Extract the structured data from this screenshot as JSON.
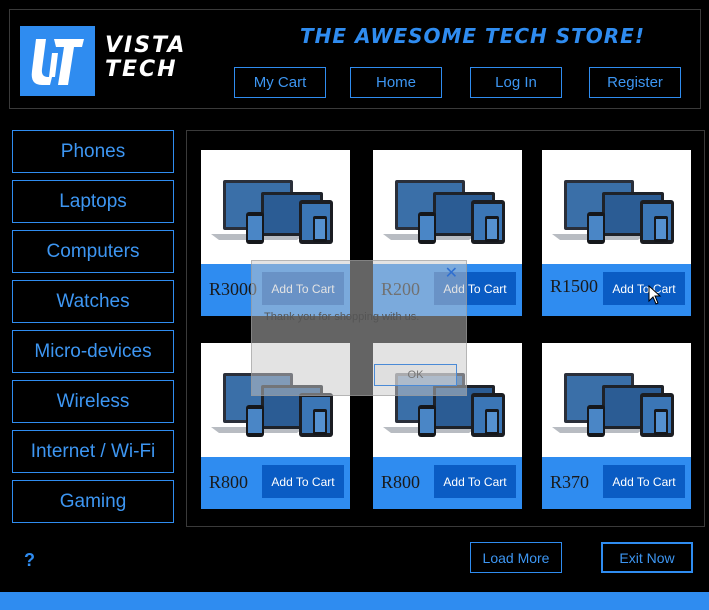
{
  "header": {
    "logo_text": "VISTA TECH",
    "tagline": "THE AWESOME TECH STORE!",
    "nav": [
      "My Cart",
      "Home",
      "Log In",
      "Register"
    ]
  },
  "sidebar": {
    "items": [
      "Phones",
      "Laptops",
      "Computers",
      "Watches",
      "Micro-devices",
      "Wireless",
      "Internet / Wi-Fi",
      "Gaming"
    ]
  },
  "products": [
    {
      "price": "R3000",
      "button": "Add To Cart"
    },
    {
      "price": "R200",
      "button": "Add To Cart"
    },
    {
      "price": "R1500",
      "button": "Add To Cart"
    },
    {
      "price": "R800",
      "button": "Add To Cart"
    },
    {
      "price": "R800",
      "button": "Add To Cart"
    },
    {
      "price": "R370",
      "button": "Add To Cart"
    }
  ],
  "dialog": {
    "message": "Thank you for shopping with us.",
    "ok": "OK",
    "close": "✕"
  },
  "footer": {
    "help": "?",
    "load_more": "Load More",
    "exit": "Exit Now"
  },
  "colors": {
    "accent": "#2f8cf0",
    "button_dark": "#0a5cc4",
    "background": "#000000"
  }
}
